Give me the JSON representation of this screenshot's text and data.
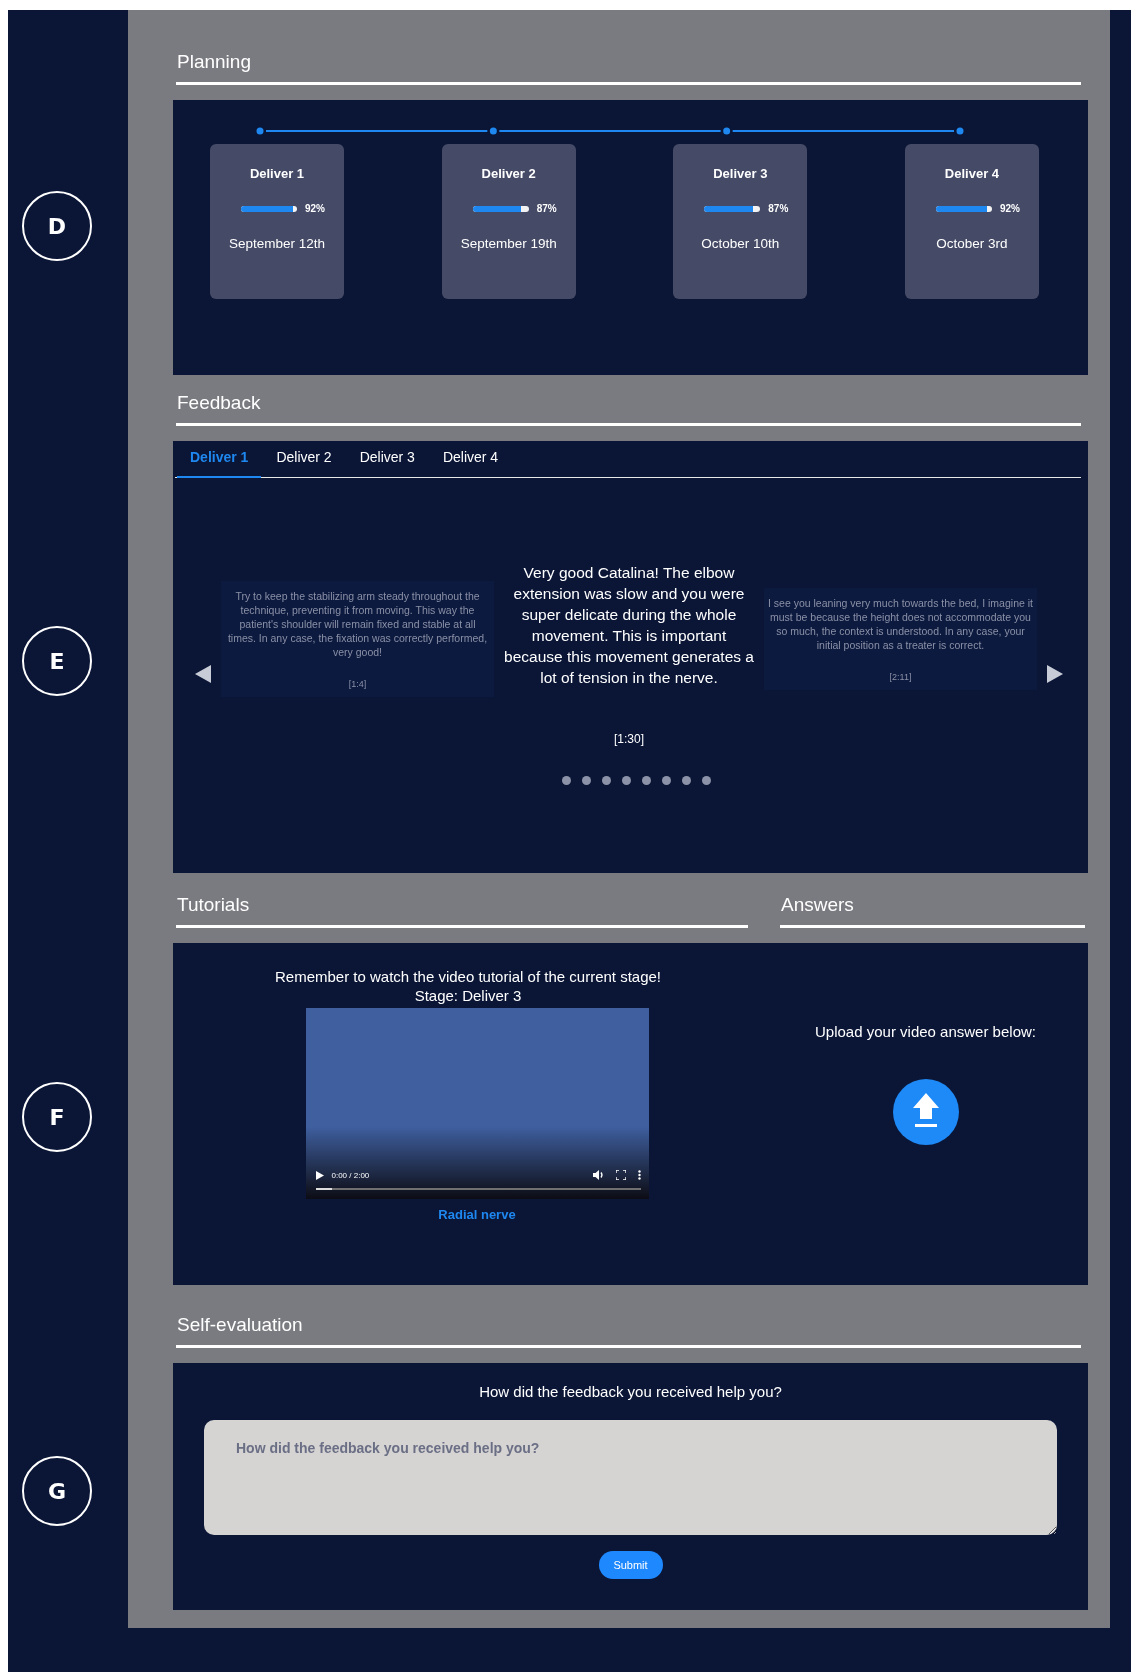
{
  "planning": {
    "marker": "D",
    "title": "Planning",
    "deliverables": [
      {
        "name": "Deliver 1",
        "level": 0.92,
        "percent": "92%",
        "date": "September 12th"
      },
      {
        "name": "Deliver 2",
        "level": 0.87,
        "percent": "87%",
        "date": "September 19th"
      },
      {
        "name": "Deliver 3",
        "level": 0.87,
        "percent": "87%",
        "date": "October 10th"
      },
      {
        "name": "Deliver 4",
        "level": 0.92,
        "percent": "92%",
        "date": "October 3rd"
      }
    ]
  },
  "feedback": {
    "marker": "E",
    "title": "Feedback",
    "tabs": [
      {
        "label": "Deliver 1",
        "selected": true
      },
      {
        "label": "Deliver 2",
        "selected": false
      },
      {
        "label": "Deliver 3",
        "selected": false
      },
      {
        "label": "Deliver 4",
        "selected": false
      }
    ],
    "slides": [
      {
        "text": "Try to keep the stabilizing arm steady throughout the technique, preventing it from moving. This way the patient's shoulder will remain fixed and stable at all times. In any case, the fixation was correctly performed, very good!",
        "time": "[1:4]",
        "selected": false
      },
      {
        "text": "Very good Catalina! The elbow extension was slow and you were super delicate during the whole movement. This is important because this movement generates a lot of tension in the nerve.",
        "time": "[1:30]",
        "selected": true
      },
      {
        "text": "I see you leaning very much towards the bed, I imagine it must be because the height does not accommodate you so much, the context is understood. In any case, your initial position as a treater is correct.",
        "time": "[2:11]",
        "selected": false
      }
    ],
    "dots": [
      {
        "selected": false
      },
      {
        "selected": false
      },
      {
        "selected": false
      },
      {
        "selected": false
      },
      {
        "selected": false
      },
      {
        "selected": false
      },
      {
        "selected": false
      },
      {
        "selected": false
      }
    ]
  },
  "tutorials": {
    "marker": "F",
    "title": "Tutorials",
    "message": "Remember to watch the video tutorial of the current stage!",
    "stage": "Stage: Deliver 3",
    "video": {
      "time": "0:00 / 2:00",
      "level": 0.05,
      "caption": "Radial nerve"
    }
  },
  "answers": {
    "title": "Answers",
    "prompt": "Upload your video answer below:"
  },
  "self_evaluation": {
    "marker": "G",
    "title": "Self-evaluation",
    "question": "How did the feedback you received help you?",
    "placeholder": "How did the feedback you received help you?",
    "submit": "Submit"
  }
}
